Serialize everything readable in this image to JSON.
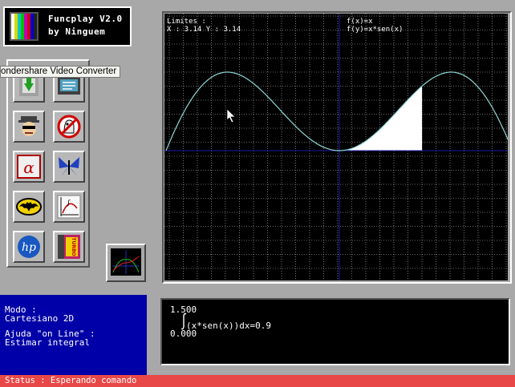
{
  "app": {
    "title_line1": "Funcplay V2.0",
    "title_line2": "by Ninguem"
  },
  "tooltip": {
    "text": "ondershare Video Converter"
  },
  "toolbar": {
    "buttons": [
      {
        "icon": "installer-icon"
      },
      {
        "icon": "screen-icon"
      },
      {
        "icon": "spy-face-icon"
      },
      {
        "icon": "ghostbusters-icon"
      },
      {
        "icon": "alpha-icon"
      },
      {
        "icon": "butterfly-icon"
      },
      {
        "icon": "batman-icon"
      },
      {
        "icon": "integral-graph-icon"
      },
      {
        "icon": "hp-logo-icon"
      },
      {
        "icon": "borland-turbo-icon"
      }
    ],
    "borland_label": "TURBO",
    "hp_label": "hp"
  },
  "graph": {
    "limits_label": "Limites :",
    "limits_values": "X : 3.14 Y : 3.14",
    "func1": "f(x)=x",
    "func2": "f(y)=x*sen(x)",
    "colors": {
      "curve": "#8fd8d8",
      "axis": "#1a1aa8",
      "grid": "#c8c8c8",
      "fill": "#ffffff"
    }
  },
  "mode_panel": {
    "mode_label": "Modo :",
    "mode_value": "Cartesiano 2D",
    "help_label": "Ajuda \"on Line\" :",
    "help_value": "Estimar integral"
  },
  "integral": {
    "upper": "1.500",
    "expression": "(x*sen(x))dx=0.9",
    "lower": "0.000"
  },
  "status": {
    "text": "Status : Esperando comando"
  }
}
